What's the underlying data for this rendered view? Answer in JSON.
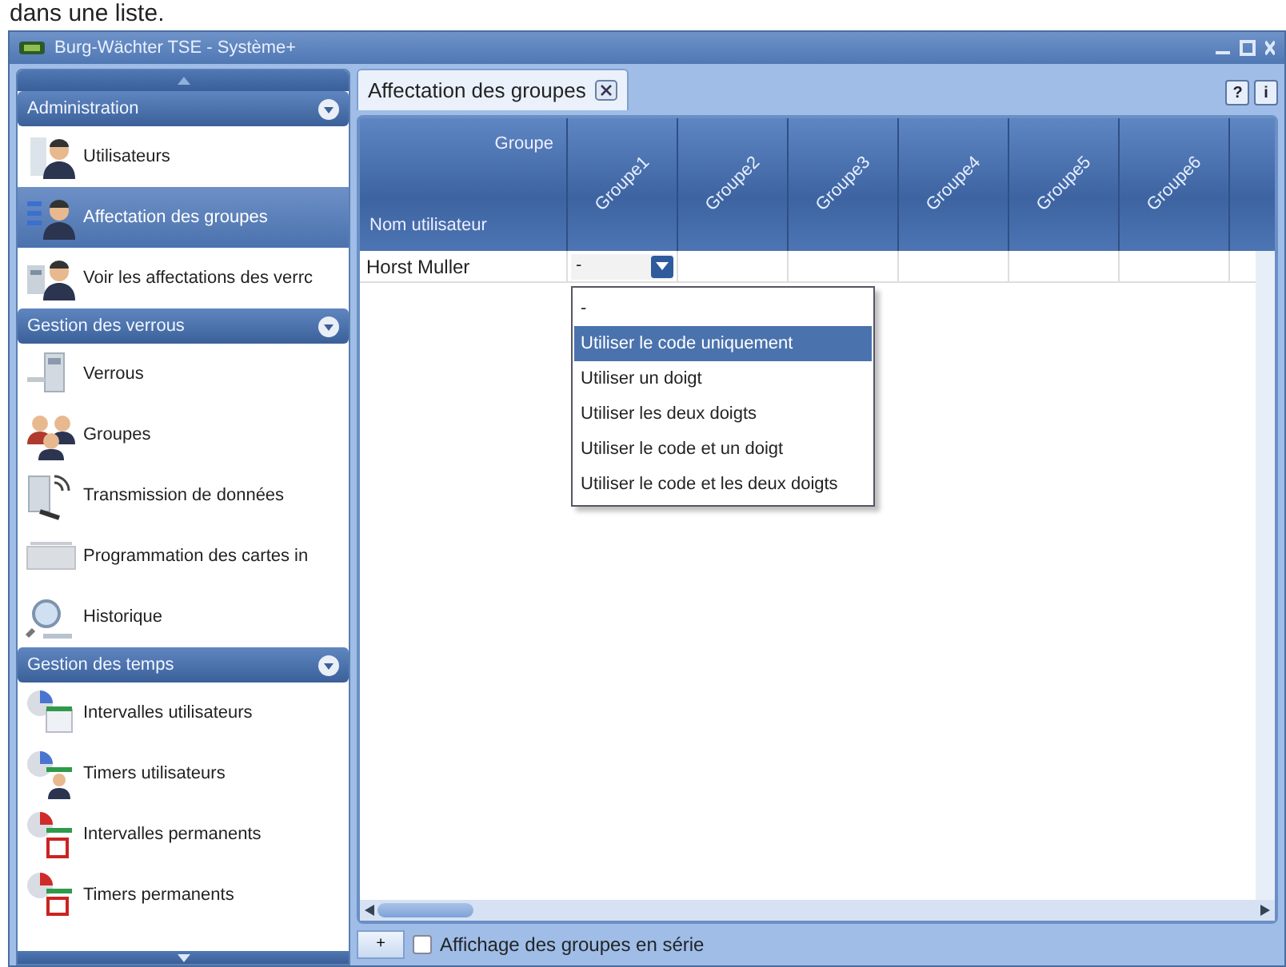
{
  "caption": "dans une liste.",
  "window": {
    "title": "Burg-Wächter TSE - Système+"
  },
  "sidebar": {
    "sections": [
      {
        "title": "Administration",
        "items": [
          {
            "label": "Utilisateurs",
            "kind": "user",
            "selected": false
          },
          {
            "label": "Affectation des groupes",
            "kind": "assign",
            "selected": true
          },
          {
            "label": "Voir les affectations des verrc",
            "kind": "viewlocks",
            "selected": false
          }
        ]
      },
      {
        "title": "Gestion des verrous",
        "items": [
          {
            "label": "Verrous",
            "kind": "lock",
            "selected": false
          },
          {
            "label": "Groupes",
            "kind": "groups",
            "selected": false
          },
          {
            "label": "Transmission de données",
            "kind": "transmit",
            "selected": false
          },
          {
            "label": "Programmation des cartes in",
            "kind": "card",
            "selected": false
          },
          {
            "label": "Historique",
            "kind": "history",
            "selected": false
          }
        ]
      },
      {
        "title": "Gestion des temps",
        "items": [
          {
            "label": "Intervalles utilisateurs",
            "kind": "interval",
            "selected": false
          },
          {
            "label": "Timers utilisateurs",
            "kind": "timer",
            "selected": false
          },
          {
            "label": "Intervalles permanents",
            "kind": "pinterval",
            "selected": false
          },
          {
            "label": "Timers permanents",
            "kind": "ptimer",
            "selected": false
          }
        ]
      }
    ]
  },
  "tabs": [
    {
      "label": "Affectation des groupes",
      "selected": true
    }
  ],
  "help_buttons": [
    "?",
    "i"
  ],
  "grid": {
    "corner_top": "Groupe",
    "corner_bottom": "Nom utilisateur",
    "columns": [
      "Groupe1",
      "Groupe2",
      "Groupe3",
      "Groupe4",
      "Groupe5",
      "Groupe6"
    ],
    "rows": [
      {
        "name": "Horst Muller",
        "cells": [
          {
            "kind": "dropdown",
            "value": "-"
          },
          {
            "kind": "empty"
          },
          {
            "kind": "empty"
          },
          {
            "kind": "empty"
          },
          {
            "kind": "empty"
          },
          {
            "kind": "empty"
          }
        ]
      }
    ],
    "dropdown": {
      "options": [
        {
          "label": "-",
          "selected": false
        },
        {
          "label": "Utiliser le code uniquement",
          "selected": true
        },
        {
          "label": "Utiliser un doigt",
          "selected": false
        },
        {
          "label": "Utiliser les deux doigts",
          "selected": false
        },
        {
          "label": "Utiliser le code et un doigt",
          "selected": false
        },
        {
          "label": "Utiliser le code et les deux doigts",
          "selected": false
        }
      ]
    }
  },
  "footer": {
    "add_button": "+",
    "checkbox": {
      "label": "Affichage des groupes en série",
      "checked": false
    }
  }
}
